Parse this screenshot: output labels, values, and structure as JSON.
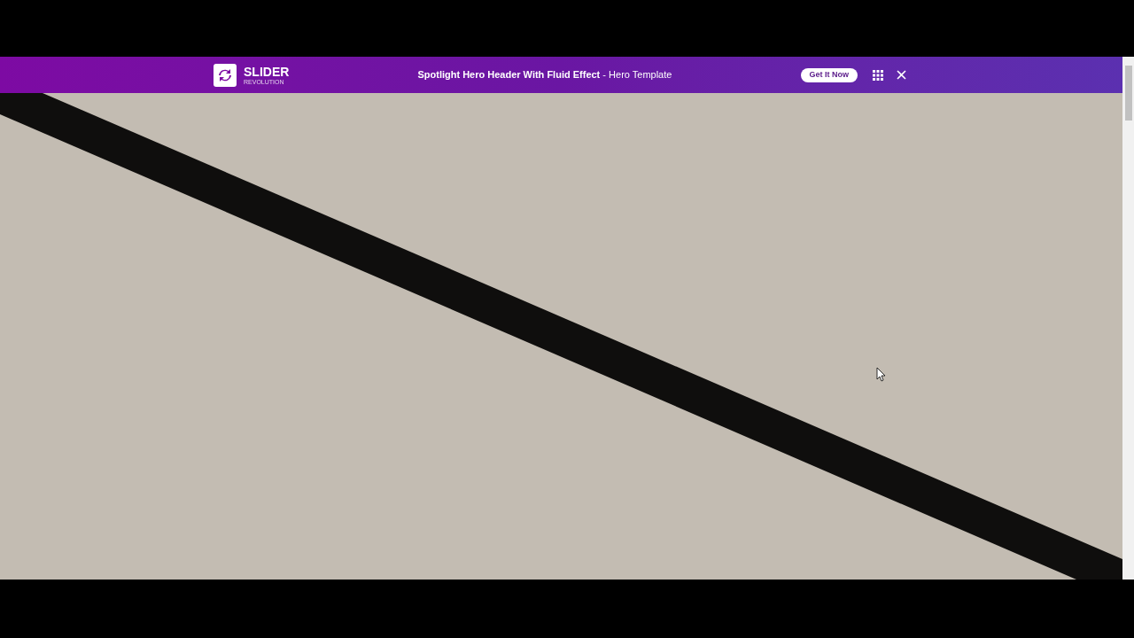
{
  "top_bar": {
    "logo_title": "SLIDER",
    "logo_subtitle": "REVOLUTION",
    "title": "**Spotlight Hero Header With Fluid Effect** - Hero Template",
    "cta_button": "Get It Now"
  }
}
